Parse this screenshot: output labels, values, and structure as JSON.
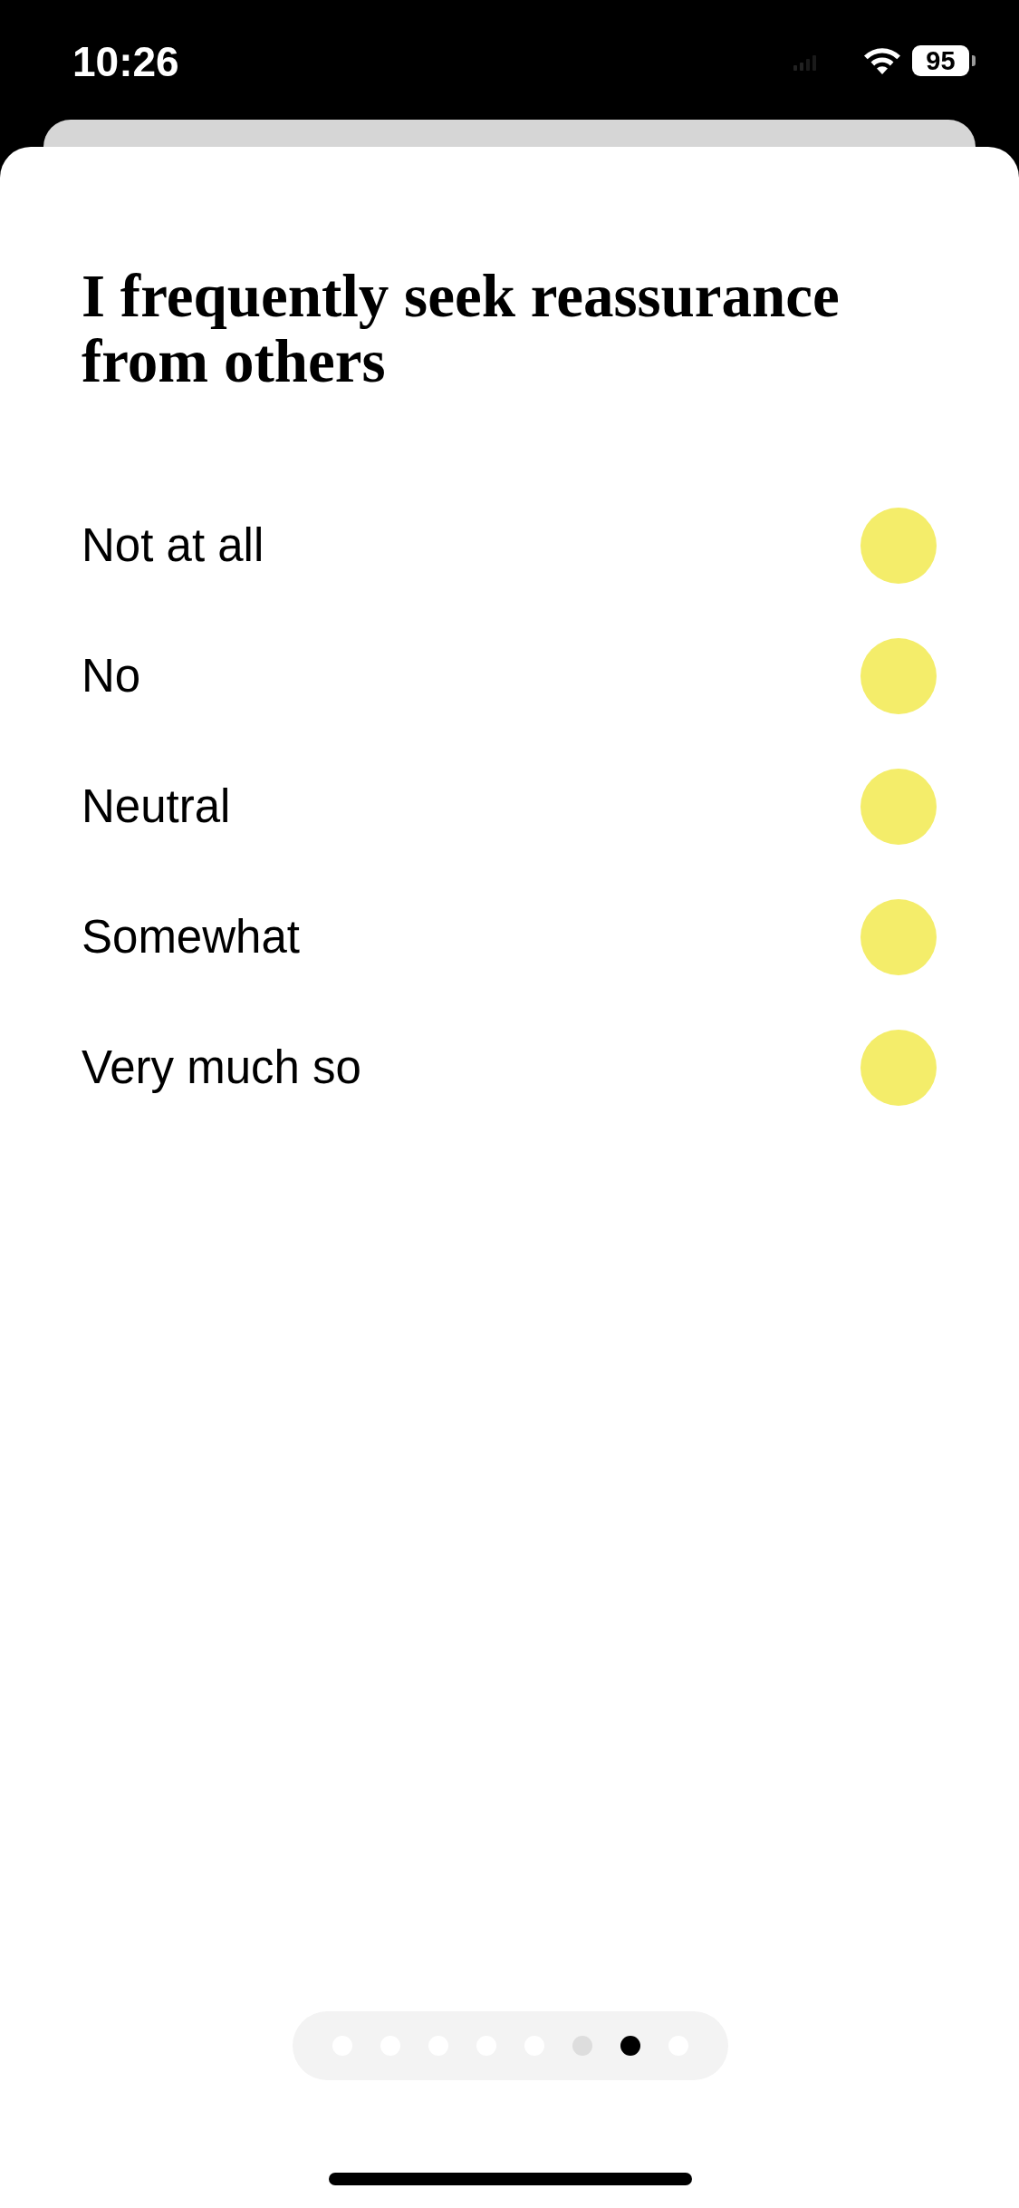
{
  "status_bar": {
    "time": "10:26",
    "battery": "95"
  },
  "question": {
    "title": "I frequently seek reassurance from others"
  },
  "options": [
    {
      "label": "Not at all",
      "selected": false
    },
    {
      "label": "No",
      "selected": false
    },
    {
      "label": "Neutral",
      "selected": false
    },
    {
      "label": "Somewhat",
      "selected": false
    },
    {
      "label": "Very much so",
      "selected": false
    }
  ],
  "pages": [
    {
      "selected": false,
      "disabled": false
    },
    {
      "selected": false,
      "disabled": false
    },
    {
      "selected": false,
      "disabled": false
    },
    {
      "selected": false,
      "disabled": false
    },
    {
      "selected": false,
      "disabled": false
    },
    {
      "selected": false,
      "disabled": true
    },
    {
      "selected": true,
      "disabled": false
    },
    {
      "selected": false,
      "disabled": false
    }
  ]
}
